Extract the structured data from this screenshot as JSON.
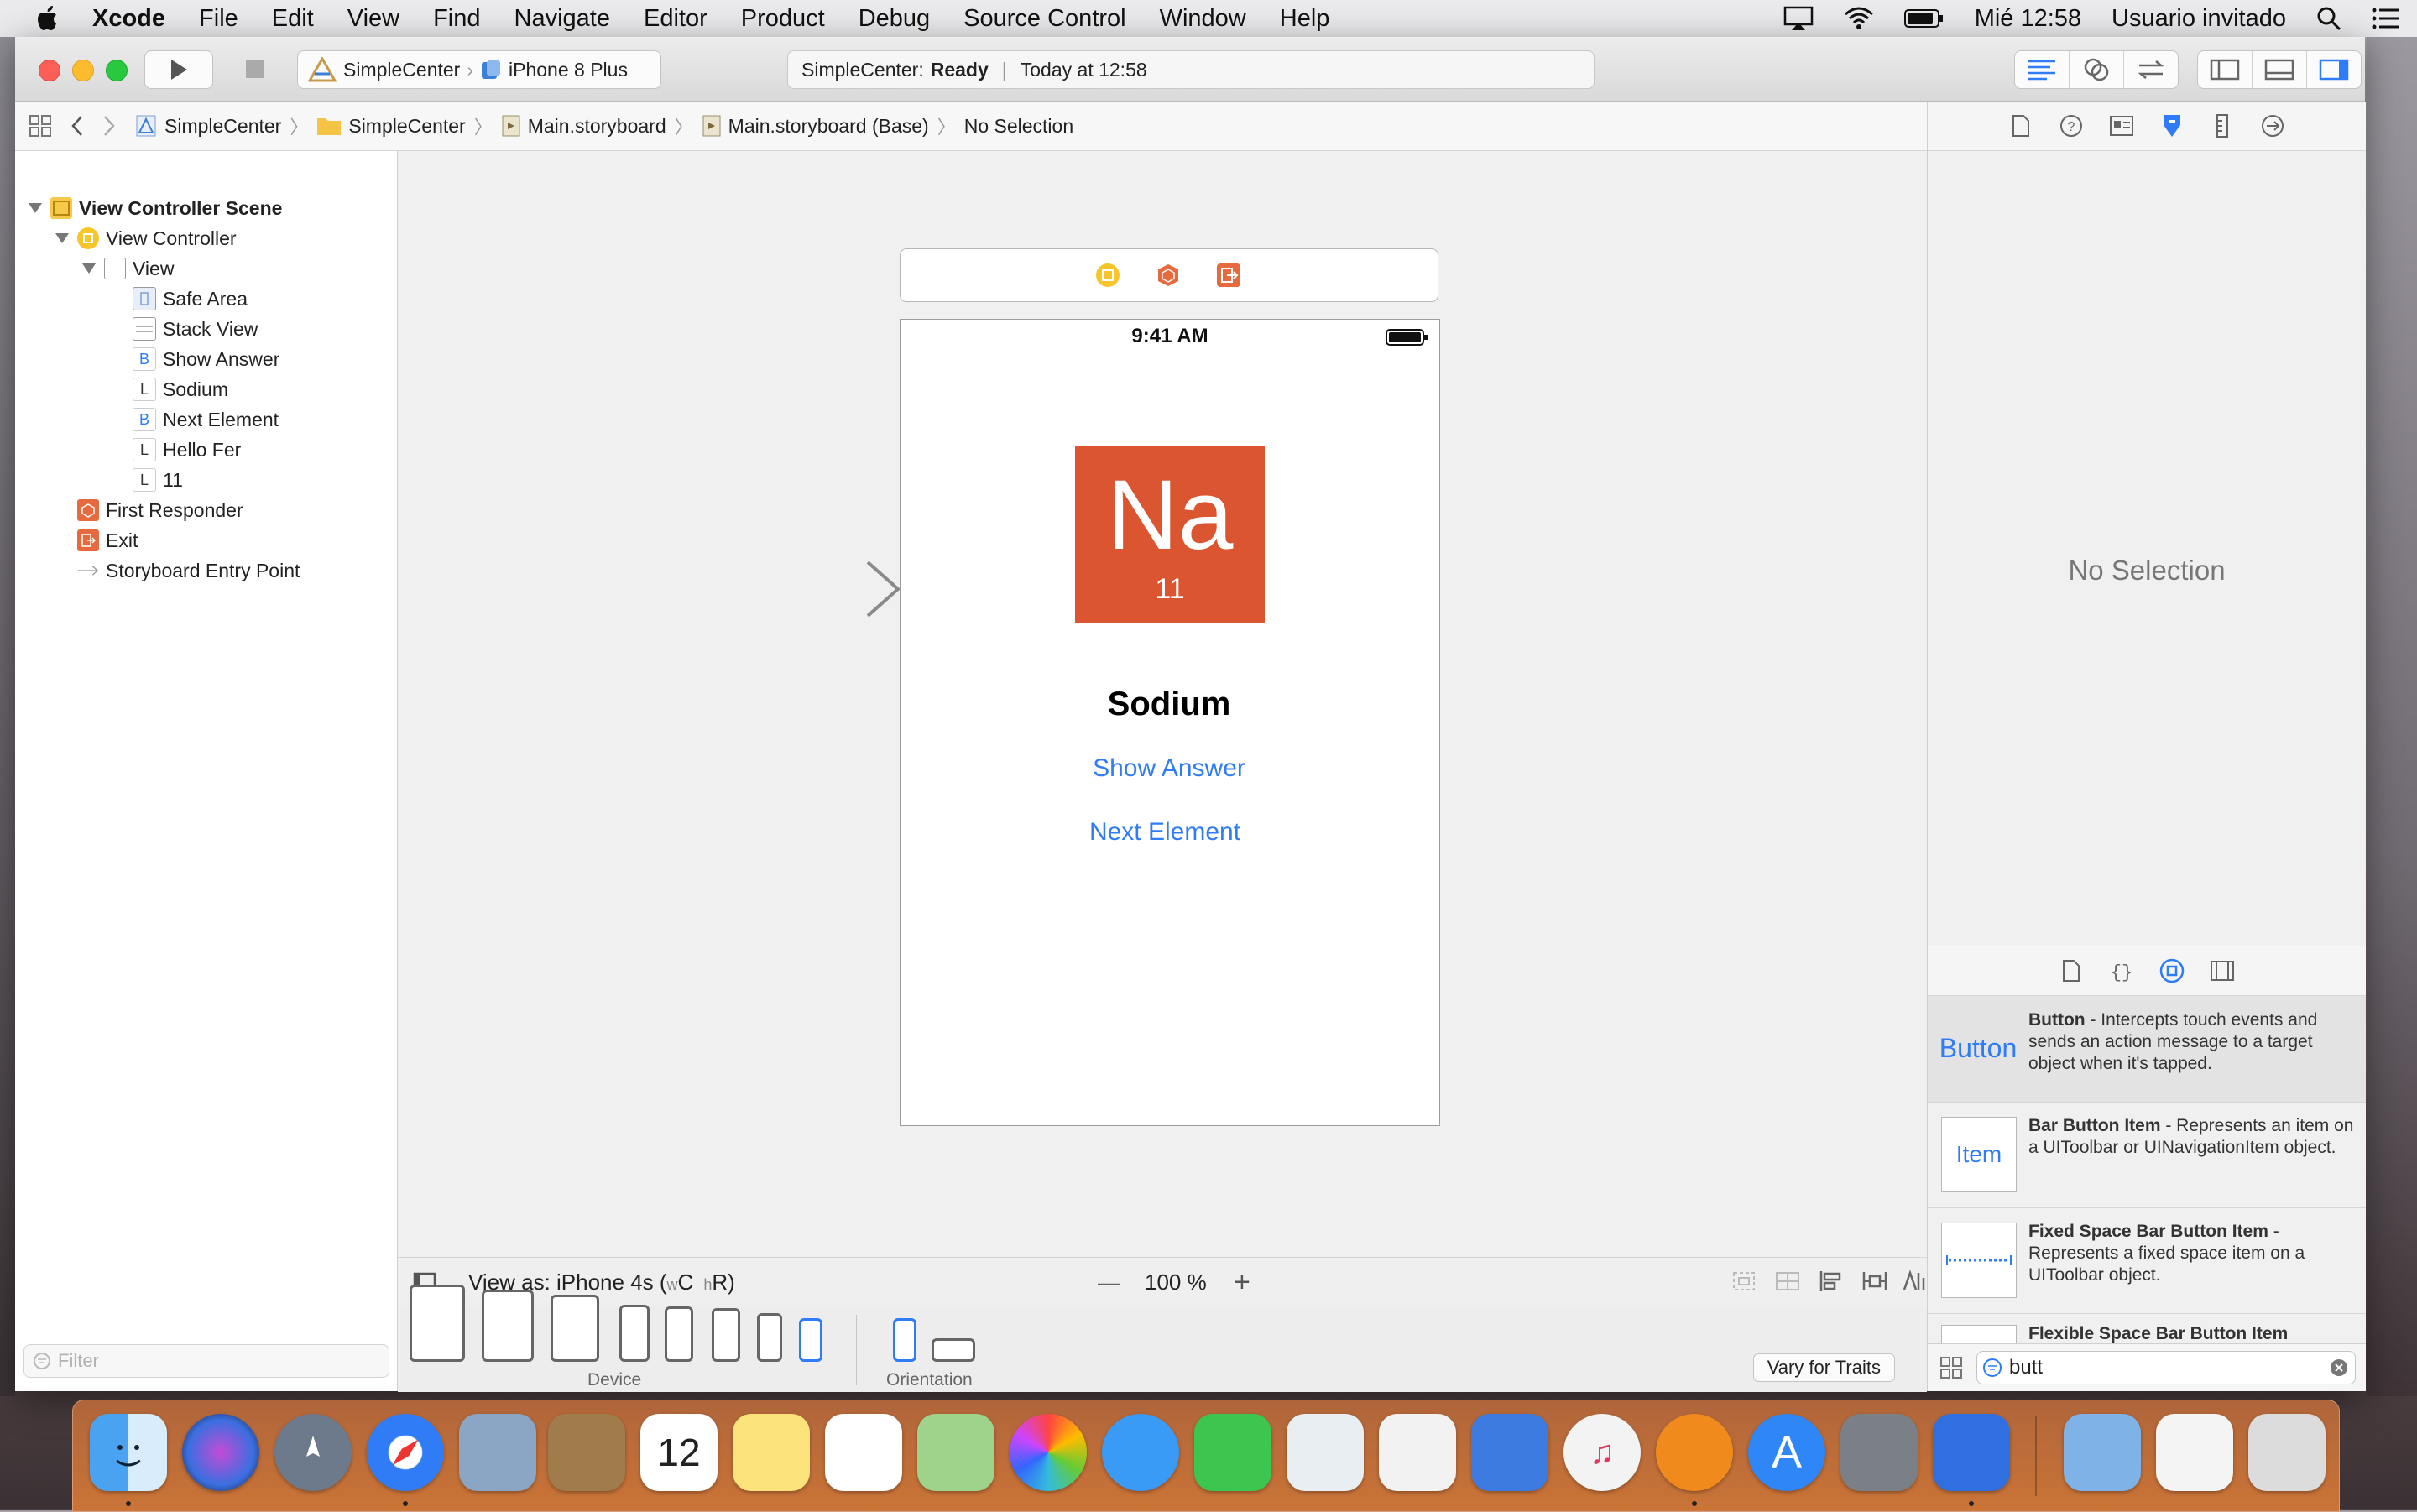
{
  "menubar": {
    "app_name": "Xcode",
    "items": [
      "File",
      "Edit",
      "View",
      "Find",
      "Navigate",
      "Editor",
      "Product",
      "Debug",
      "Source Control",
      "Window",
      "Help"
    ],
    "clock": "Mié 12:58",
    "user": "Usuario invitado"
  },
  "toolbar": {
    "scheme": "SimpleCenter",
    "device": "iPhone 8 Plus",
    "activity_project": "SimpleCenter:",
    "activity_status": "Ready",
    "activity_time": "Today at 12:58"
  },
  "jumpbar": {
    "crumbs": [
      "SimpleCenter",
      "SimpleCenter",
      "Main.storyboard",
      "Main.storyboard (Base)",
      "No Selection"
    ]
  },
  "outline": {
    "scene": "View Controller Scene",
    "view_controller": "View Controller",
    "view": "View",
    "children": [
      {
        "label": "Safe Area",
        "badge": ""
      },
      {
        "label": "Stack View",
        "badge": ""
      },
      {
        "label": "Show Answer",
        "badge": "B"
      },
      {
        "label": "Sodium",
        "badge": "L"
      },
      {
        "label": "Next Element",
        "badge": "B"
      },
      {
        "label": "Hello Fer",
        "badge": "L"
      },
      {
        "label": "11",
        "badge": "L"
      }
    ],
    "first_responder": "First Responder",
    "exit": "Exit",
    "entry_point": "Storyboard Entry Point",
    "filter_placeholder": "Filter"
  },
  "canvas": {
    "status_time": "9:41 AM",
    "element_symbol": "Na",
    "element_number": "11",
    "element_name": "Sodium",
    "show_answer": "Show Answer",
    "next_element": "Next Element",
    "view_as": "View as: iPhone 4s (",
    "view_as_w": "w",
    "view_as_c": "C",
    "view_as_h": "h",
    "view_as_r": "R)",
    "zoom_minus": "—",
    "zoom": "100 %",
    "zoom_plus": "+",
    "device_label": "Device",
    "orientation_label": "Orientation",
    "vary_for_traits": "Vary for Traits"
  },
  "inspector": {
    "no_selection": "No Selection",
    "library": [
      {
        "thumb": "Button",
        "title": "Button",
        "desc": " - Intercepts touch events and sends an action message to a target object when it's tapped."
      },
      {
        "thumb": "Item",
        "title": "Bar Button Item",
        "desc": " - Represents an item on a UIToolbar or UINavigationItem object."
      },
      {
        "thumb": "",
        "title": "Fixed Space Bar Button Item",
        "desc": " - Represents a fixed space item on a UIToolbar object."
      },
      {
        "thumb": "",
        "title": "Flexible Space Bar Button Item",
        "desc": ""
      }
    ],
    "search_value": "butt"
  },
  "colors": {
    "accent": "#2f7cf6",
    "sodium_tile": "#db5630"
  }
}
